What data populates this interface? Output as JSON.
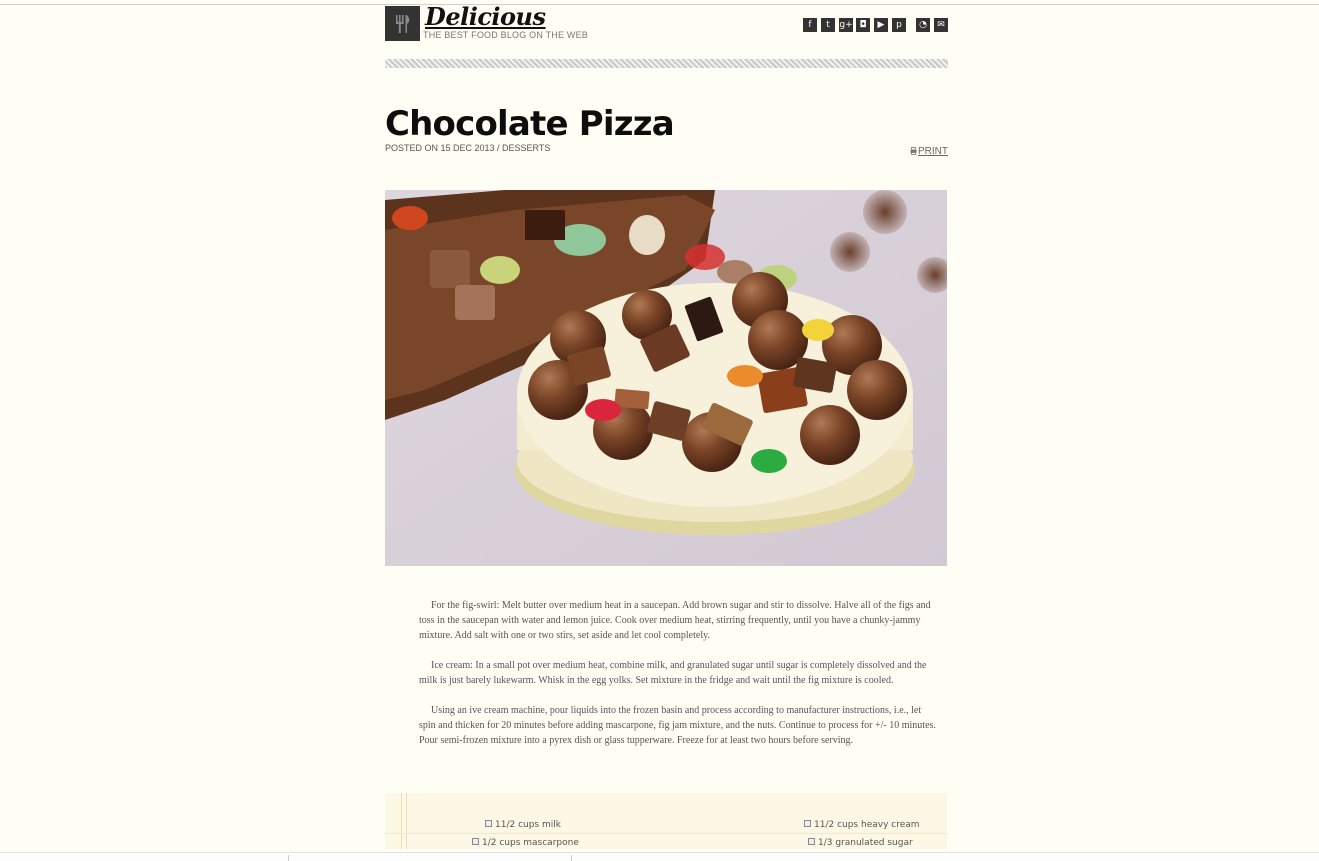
{
  "site": {
    "title": "Delicious",
    "tagline": "THE BEST FOOD BLOG ON THE WEB"
  },
  "social": [
    {
      "icon": "facebook-icon",
      "glyph": "f"
    },
    {
      "icon": "twitter-icon",
      "glyph": "t"
    },
    {
      "icon": "google-plus-icon",
      "glyph": "g+"
    },
    {
      "icon": "instagram-icon",
      "glyph": "◘"
    },
    {
      "icon": "youtube-icon",
      "glyph": "▶"
    },
    {
      "icon": "pinterest-icon",
      "glyph": "p"
    },
    {
      "icon": "rss-icon",
      "glyph": "◔"
    },
    {
      "icon": "email-icon",
      "glyph": "✉"
    }
  ],
  "post": {
    "title": "Chocolate Pizza",
    "meta": "POSTED ON 15 DEC 2013 / DESSERTS",
    "print_label": "PRINT",
    "paragraphs": [
      "For the fig-swirl: Melt butter over medium heat in a saucepan. Add brown sugar and stir to dissolve. Halve all of the figs and toss in the saucepan with water and lemon juice. Cook over medium heat, stirring frequently, until you have a chunky-jammy mixture. Add salt with one or two stirs, set aside and let cool completely.",
      "Ice cream: In a small pot over medium heat, combine milk, and granulated sugar until sugar is completely dissolved and the milk is just barely lukewarm. Whisk in the egg yolks. Set mixture in the fridge and wait until the fig mixture is cooled.",
      "Using an ive cream machine, pour liquids into the frozen basin and process according to manufacturer instructions, i.e., let spin and thicken for 20 minutes before adding mascarpone, fig jam mixture, and the nuts. Continue to process for +/- 10 minutes. Pour semi-frozen mixture into a pyrex dish or glass tupperware. Freeze for at least two hours before serving."
    ]
  },
  "ingredients": [
    "11/2 cups milk",
    "11/2 cups heavy cream",
    "1/2 cups mascarpone",
    "1/3 granulated sugar"
  ],
  "colors": {
    "background": "#fffef5",
    "title": "#0d0d0d",
    "icon_bg": "#333333",
    "recipe_bg": "#fdf8e6"
  }
}
